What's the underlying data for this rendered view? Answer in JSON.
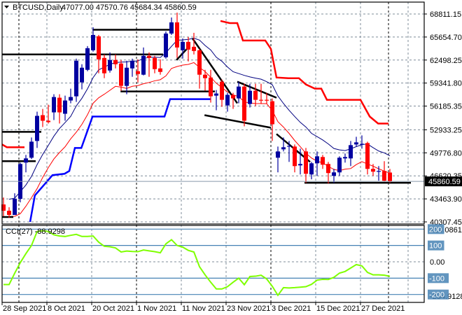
{
  "chart_data": {
    "type": "candlestick",
    "title": {
      "symbol": "BTCUSD,Daily",
      "ohlc": "47077.00 47570.76 45684.34 45860.59"
    },
    "price_axis": {
      "ticks": [
        "68811.15",
        "65654.70",
        "62498.25",
        "59341.80",
        "56185.35",
        "52933.25",
        "49776.80",
        "46620.35",
        "43463.90",
        "40307.45"
      ],
      "range": [
        40307.45,
        68811.15
      ],
      "current": "45860.59"
    },
    "date_axis": {
      "labels": [
        {
          "bar": 0,
          "label": "28 Sep 2021"
        },
        {
          "bar": 8,
          "label": "8 Oct 2021"
        },
        {
          "bar": 16,
          "label": "20 Oct 2021"
        },
        {
          "bar": 24,
          "label": "1 Nov 2021"
        },
        {
          "bar": 32,
          "label": "11 Nov 2021"
        },
        {
          "bar": 40,
          "label": "23 Nov 2021"
        },
        {
          "bar": 48,
          "label": "3 Dec 2021"
        },
        {
          "bar": 56,
          "label": "15 Dec 2021"
        },
        {
          "bar": 64,
          "label": "27 Dec 2021"
        }
      ],
      "separators": [
        2.75,
        23.75,
        47.75,
        68.75
      ]
    },
    "candles_ohlc": [
      [
        42699,
        43656,
        41074,
        41838
      ],
      [
        41838,
        42316,
        40882,
        41265
      ],
      [
        41265,
        44230,
        41265,
        43465
      ],
      [
        43465,
        48438,
        42986,
        48247
      ],
      [
        48438,
        49490,
        47099,
        49012
      ],
      [
        49107,
        51881,
        48916,
        51307
      ],
      [
        51403,
        55421,
        50447,
        54846
      ],
      [
        54942,
        55803,
        53315,
        54176
      ],
      [
        54176,
        56377,
        53794,
        53985
      ],
      [
        55324,
        57811,
        54272,
        57429
      ],
      [
        57333,
        57811,
        53794,
        55324
      ],
      [
        55133,
        57620,
        54176,
        56951
      ],
      [
        56951,
        58577,
        56568,
        57429
      ],
      [
        57525,
        62689,
        56759,
        62403
      ],
      [
        59437,
        61924,
        58481,
        61446
      ],
      [
        61159,
        64411,
        60968,
        64124
      ],
      [
        63837,
        66994,
        63646,
        65942
      ],
      [
        65750,
        65942,
        60681,
        62594
      ],
      [
        62785,
        63263,
        60011,
        60681
      ],
      [
        61063,
        63550,
        60776,
        62498
      ],
      [
        62498,
        63263,
        61350,
        61924
      ],
      [
        62020,
        62498,
        58290,
        58959
      ],
      [
        58959,
        62403,
        57811,
        61446
      ],
      [
        61350,
        62689,
        60203,
        62403
      ],
      [
        60968,
        62594,
        59437,
        60585
      ],
      [
        60490,
        64220,
        60394,
        63072
      ],
      [
        63072,
        63550,
        60203,
        62785
      ],
      [
        62785,
        63072,
        60681,
        61255
      ],
      [
        61350,
        62594,
        60490,
        60872
      ],
      [
        62881,
        66420,
        62689,
        66133
      ],
      [
        66133,
        68333,
        65942,
        67663
      ],
      [
        67663,
        69002,
        62785,
        64220
      ],
      [
        63837,
        65463,
        62689,
        64985
      ],
      [
        64985,
        65655,
        62307,
        63933
      ],
      [
        64315,
        66229,
        63263,
        63742
      ],
      [
        63837,
        64029,
        58577,
        60490
      ],
      [
        60490,
        61159,
        58290,
        60011
      ],
      [
        60107,
        61159,
        56664,
        57525
      ],
      [
        57620,
        58385,
        55612,
        57907
      ],
      [
        59533,
        59820,
        56090,
        57046
      ],
      [
        56281,
        58002,
        55421,
        57716
      ],
      [
        57716,
        58002,
        55803,
        57238
      ],
      [
        57238,
        59533,
        56568,
        58863
      ],
      [
        58863,
        59246,
        53411,
        54176
      ],
      [
        56472,
        59246,
        55994,
        58290
      ],
      [
        58290,
        59246,
        56185,
        57046
      ],
      [
        57046,
        59246,
        56472,
        56951
      ],
      [
        57046,
        58002,
        56472,
        56951
      ],
      [
        56855,
        57238,
        51403,
        53698
      ],
      [
        49107,
        50638,
        47099,
        49968
      ],
      [
        50255,
        51881,
        49968,
        50542
      ],
      [
        50638,
        51403,
        48533,
        50733
      ],
      [
        50638,
        50925,
        47099,
        47960
      ],
      [
        48056,
        50351,
        46812,
        48247
      ],
      [
        49968,
        50447,
        45665,
        46908
      ],
      [
        46812,
        48533,
        46143,
        48343
      ],
      [
        48343,
        49968,
        46621,
        49298
      ],
      [
        49203,
        49490,
        47577,
        48151
      ],
      [
        48247,
        48533,
        45569,
        47003
      ],
      [
        46621,
        47577,
        45665,
        47099
      ],
      [
        47099,
        49298,
        46621,
        49107
      ],
      [
        49012,
        49681,
        48438,
        49203
      ],
      [
        49012,
        51403,
        47960,
        50829
      ],
      [
        50925,
        51977,
        50638,
        51212
      ],
      [
        50925,
        52168,
        50351,
        51020
      ],
      [
        51116,
        51307,
        46812,
        47577
      ],
      [
        47577,
        48247,
        46621,
        47195
      ],
      [
        47195,
        47960,
        45952,
        47290
      ],
      [
        47290,
        48629,
        45857,
        45952
      ],
      [
        47077.0,
        47570.76,
        45684.34,
        45860.59
      ]
    ],
    "support_step": [
      [
        4.75,
        40307
      ],
      [
        5.6,
        43942
      ],
      [
        8.75,
        46716
      ],
      [
        10.9,
        46907
      ],
      [
        11.75,
        47289
      ],
      [
        12.75,
        50446
      ],
      [
        13.9,
        50446
      ],
      [
        15.9,
        54750
      ],
      [
        28.75,
        54750
      ],
      [
        29.75,
        57142
      ],
      [
        37,
        57142
      ]
    ],
    "resistance_step": [
      [
        38.75,
        67855
      ],
      [
        40.4,
        67568
      ],
      [
        41.75,
        67568
      ],
      [
        42.75,
        65177
      ],
      [
        46.75,
        65177
      ],
      [
        47.75,
        64029
      ],
      [
        48.75,
        60107
      ],
      [
        50.9,
        60011
      ],
      [
        52.75,
        60011
      ],
      [
        54,
        59150
      ],
      [
        55.6,
        58577
      ],
      [
        56.75,
        58577
      ],
      [
        57.75,
        57046
      ],
      [
        63.75,
        57046
      ],
      [
        65.4,
        54750
      ],
      [
        66.9,
        53794
      ],
      [
        68.75,
        53794
      ]
    ],
    "early_resistance": [
      [
        -0.25,
        50925
      ],
      [
        0.6,
        50542
      ],
      [
        3.75,
        50542
      ]
    ],
    "trendlines": [
      [
        [
          15.9,
          66650
        ],
        [
          29.75,
          66650
        ]
      ],
      [
        [
          -0.25,
          63263
        ],
        [
          28.5,
          63263
        ]
      ],
      [
        [
          20.9,
          58194
        ],
        [
          37.75,
          58194
        ]
      ],
      [
        [
          30.9,
          62500
        ],
        [
          32.75,
          64029
        ]
      ],
      [
        [
          33.75,
          65463
        ],
        [
          41.75,
          56568
        ]
      ],
      [
        [
          41.75,
          59533
        ],
        [
          48.75,
          57333
        ]
      ],
      [
        [
          35.9,
          54942
        ],
        [
          47.75,
          53220
        ]
      ],
      [
        [
          48.75,
          52360
        ],
        [
          54.75,
          48533
        ]
      ],
      [
        [
          53.75,
          45665
        ],
        [
          72.75,
          45665
        ]
      ],
      [
        [
          -0.25,
          52647
        ],
        [
          6.75,
          52647
        ]
      ],
      [
        [
          -0.25,
          48629
        ],
        [
          5.75,
          48629
        ]
      ],
      [
        [
          -0.25,
          40977
        ],
        [
          1.75,
          40977
        ]
      ]
    ],
    "colors": {
      "bull": "#0000a0",
      "bear": "#ff0000",
      "ma_high": "#000080",
      "ma_low": "#ff0000",
      "support": "#0000ff",
      "cci": "#7fff00",
      "level": "#4682b4"
    },
    "cci": {
      "label": "CCI(27) -88.9298",
      "range": [
        -234.9128,
        214.0861
      ],
      "axis_max": "214.0861",
      "axis_min": "-234.9128",
      "levels": [
        {
          "value": 200,
          "label": "200"
        },
        {
          "value": 100,
          "label": "100"
        },
        {
          "value": -100,
          "label": "-100"
        },
        {
          "value": -200,
          "label": "-200"
        }
      ],
      "zero_label": "0.00",
      "values": [
        -139,
        -139,
        -70,
        -5,
        50,
        100,
        185,
        190,
        185,
        165,
        158,
        155,
        162,
        168,
        155,
        155,
        158,
        120,
        95,
        92,
        85,
        60,
        66,
        63,
        62,
        72,
        67,
        62,
        55,
        110,
        135,
        100,
        90,
        70,
        60,
        -30,
        -80,
        -125,
        -166,
        -166,
        -152,
        -125,
        -100,
        -140,
        -90,
        -88,
        -82,
        -105,
        -150,
        -205,
        -158,
        -160,
        -158,
        -155,
        -152,
        -138,
        -112,
        -107,
        -108,
        -95,
        -69,
        -59,
        -38,
        -17,
        -25,
        -65,
        -80,
        -80,
        -82,
        -88.93
      ]
    }
  }
}
